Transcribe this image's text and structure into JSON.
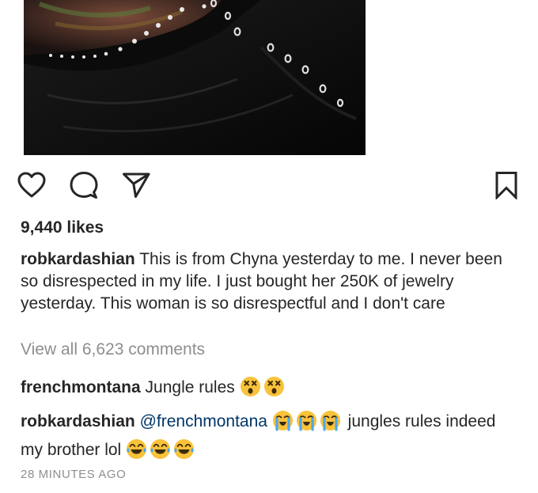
{
  "post": {
    "likes_text": "9,440 likes",
    "caption": {
      "username": "robkardashian",
      "text": "This is from Chyna yesterday to me. I never been so disrespected in my life. I just bought her 250K of jewelry yesterday. This woman is so disrespectful and I don't care"
    },
    "view_all_comments": "View all 6,623 comments",
    "comments": [
      {
        "username": "frenchmontana",
        "text": "Jungle rules",
        "emojis": [
          "dizzy-face-emoji",
          "dizzy-face-emoji"
        ]
      },
      {
        "username": "robkardashian",
        "mention": "@frenchmontana",
        "mention_emojis": [
          "loudly-crying-face-emoji",
          "loudly-crying-face-emoji",
          "loudly-crying-face-emoji"
        ],
        "text": "jungles rules indeed my brother lol",
        "emojis": [
          "tears-of-joy-emoji",
          "tears-of-joy-emoji",
          "tears-of-joy-emoji"
        ]
      }
    ],
    "timestamp": "28 MINUTES AGO"
  },
  "icons": {
    "like": "heart-outline-icon",
    "comment": "speech-bubble-icon",
    "share": "paper-plane-icon",
    "save": "bookmark-outline-icon"
  },
  "colors": {
    "text": "#262626",
    "muted": "#8e8e8e",
    "mention": "#003569",
    "emoji_yellow": "#f8c23a"
  }
}
